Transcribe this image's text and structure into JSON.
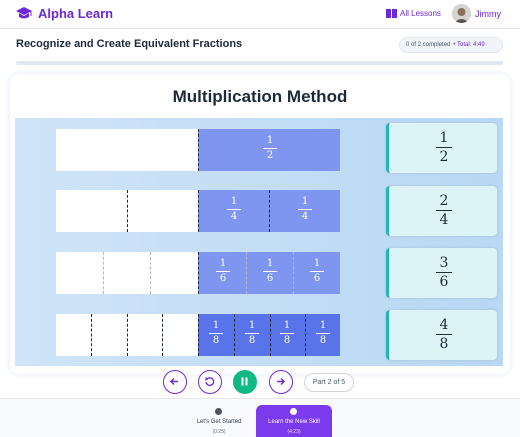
{
  "app": {
    "brand": "Alpha Learn",
    "nav_link": "All Lessons",
    "user_name": "Jimmy",
    "accent": "#6d28d9"
  },
  "lesson": {
    "title": "Recognize and Create Equivalent Fractions",
    "completed_text": "0 of 2 completed",
    "total_text": "Total: 4:49",
    "progress": 0
  },
  "panel": {
    "title": "Multiplication Method",
    "rows": [
      {
        "parts": [
          {
            "num": "1",
            "den": "2"
          }
        ],
        "result": {
          "num": "1",
          "den": "2"
        }
      },
      {
        "parts": [
          {
            "num": "1",
            "den": "4"
          },
          {
            "num": "1",
            "den": "4"
          }
        ],
        "result": {
          "num": "2",
          "den": "4"
        }
      },
      {
        "parts": [
          {
            "num": "1",
            "den": "6"
          },
          {
            "num": "1",
            "den": "6"
          },
          {
            "num": "1",
            "den": "6"
          }
        ],
        "result": {
          "num": "3",
          "den": "6"
        }
      },
      {
        "parts": [
          {
            "num": "1",
            "den": "8"
          },
          {
            "num": "1",
            "den": "8"
          },
          {
            "num": "1",
            "den": "8"
          },
          {
            "num": "1",
            "den": "8"
          }
        ],
        "result": {
          "num": "4",
          "den": "8"
        }
      }
    ]
  },
  "controls": {
    "part_text": "Part 2 of 5",
    "icons": [
      "arrow-left-icon",
      "replay-icon",
      "pause-icon",
      "arrow-right-icon"
    ]
  },
  "steps": [
    {
      "label": "Let's Get Started",
      "time": "(0:25)",
      "state": "inactive"
    },
    {
      "label": "Learn the New Skill",
      "time": "(4:23)",
      "state": "active"
    }
  ]
}
